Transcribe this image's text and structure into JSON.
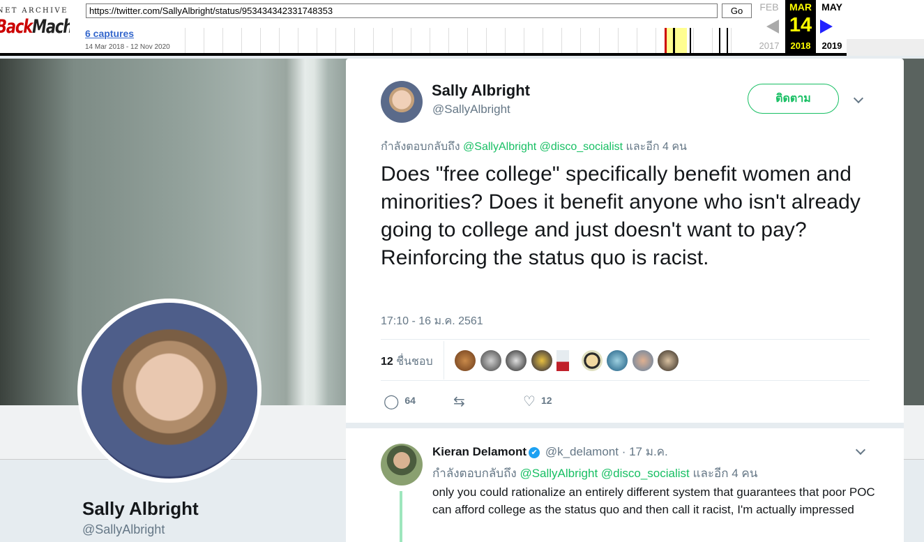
{
  "wayback": {
    "logo_top": "RNET ARCHIVE",
    "logo_main_b": "Back",
    "logo_main": "Machine",
    "url": "https://twitter.com/SallyAlbright/status/953434342331748353",
    "go_label": "Go",
    "captures_label": "6 captures",
    "date_range": "14 Mar 2018 - 12 Nov 2020",
    "prev_month": "FEB",
    "prev_year": "2017",
    "cur_month": "MAR",
    "cur_day": "14",
    "cur_year": "2018",
    "next_month": "MAY",
    "next_year": "2019"
  },
  "profile": {
    "name": "Sally Albright",
    "handle": "@SallyAlbright"
  },
  "tweet": {
    "author_name": "Sally Albright",
    "author_handle": "@SallyAlbright",
    "follow_label": "ติดตาม",
    "replying_prefix": "กำลังตอบกลับถึง",
    "replying_mentions": "@SallyAlbright @disco_socialist",
    "replying_suffix": "และอีก 4 คน",
    "text": "Does \"free college\" specifically benefit women and minorities? Does it benefit anyone who isn't already going to college and just doesn't want to pay? Reinforcing the status quo is racist.",
    "timestamp": "17:10 - 16 ม.ค. 2561",
    "likes_count": "12",
    "likes_label": "ชื่นชอบ",
    "reply_count": "64",
    "retweet_count": "",
    "like_count": "12"
  },
  "reply": {
    "author_name": "Kieran Delamont",
    "verified_icon": "✔",
    "author_handle": "@k_delamont",
    "date": "· 17 ม.ค.",
    "replying_prefix": "กำลังตอบกลับถึง",
    "replying_mentions": "@SallyAlbright @disco_socialist",
    "replying_suffix": "และอีก 4 คน",
    "text": "only you could rationalize an entirely different system that guarantees that poor POC can afford college as the status quo and then call it racist, I'm actually impressed"
  },
  "colors": {
    "accent_green": "#17bf63",
    "text_primary": "#14171a",
    "text_secondary": "#657786",
    "wayback_highlight": "#ffff00"
  }
}
